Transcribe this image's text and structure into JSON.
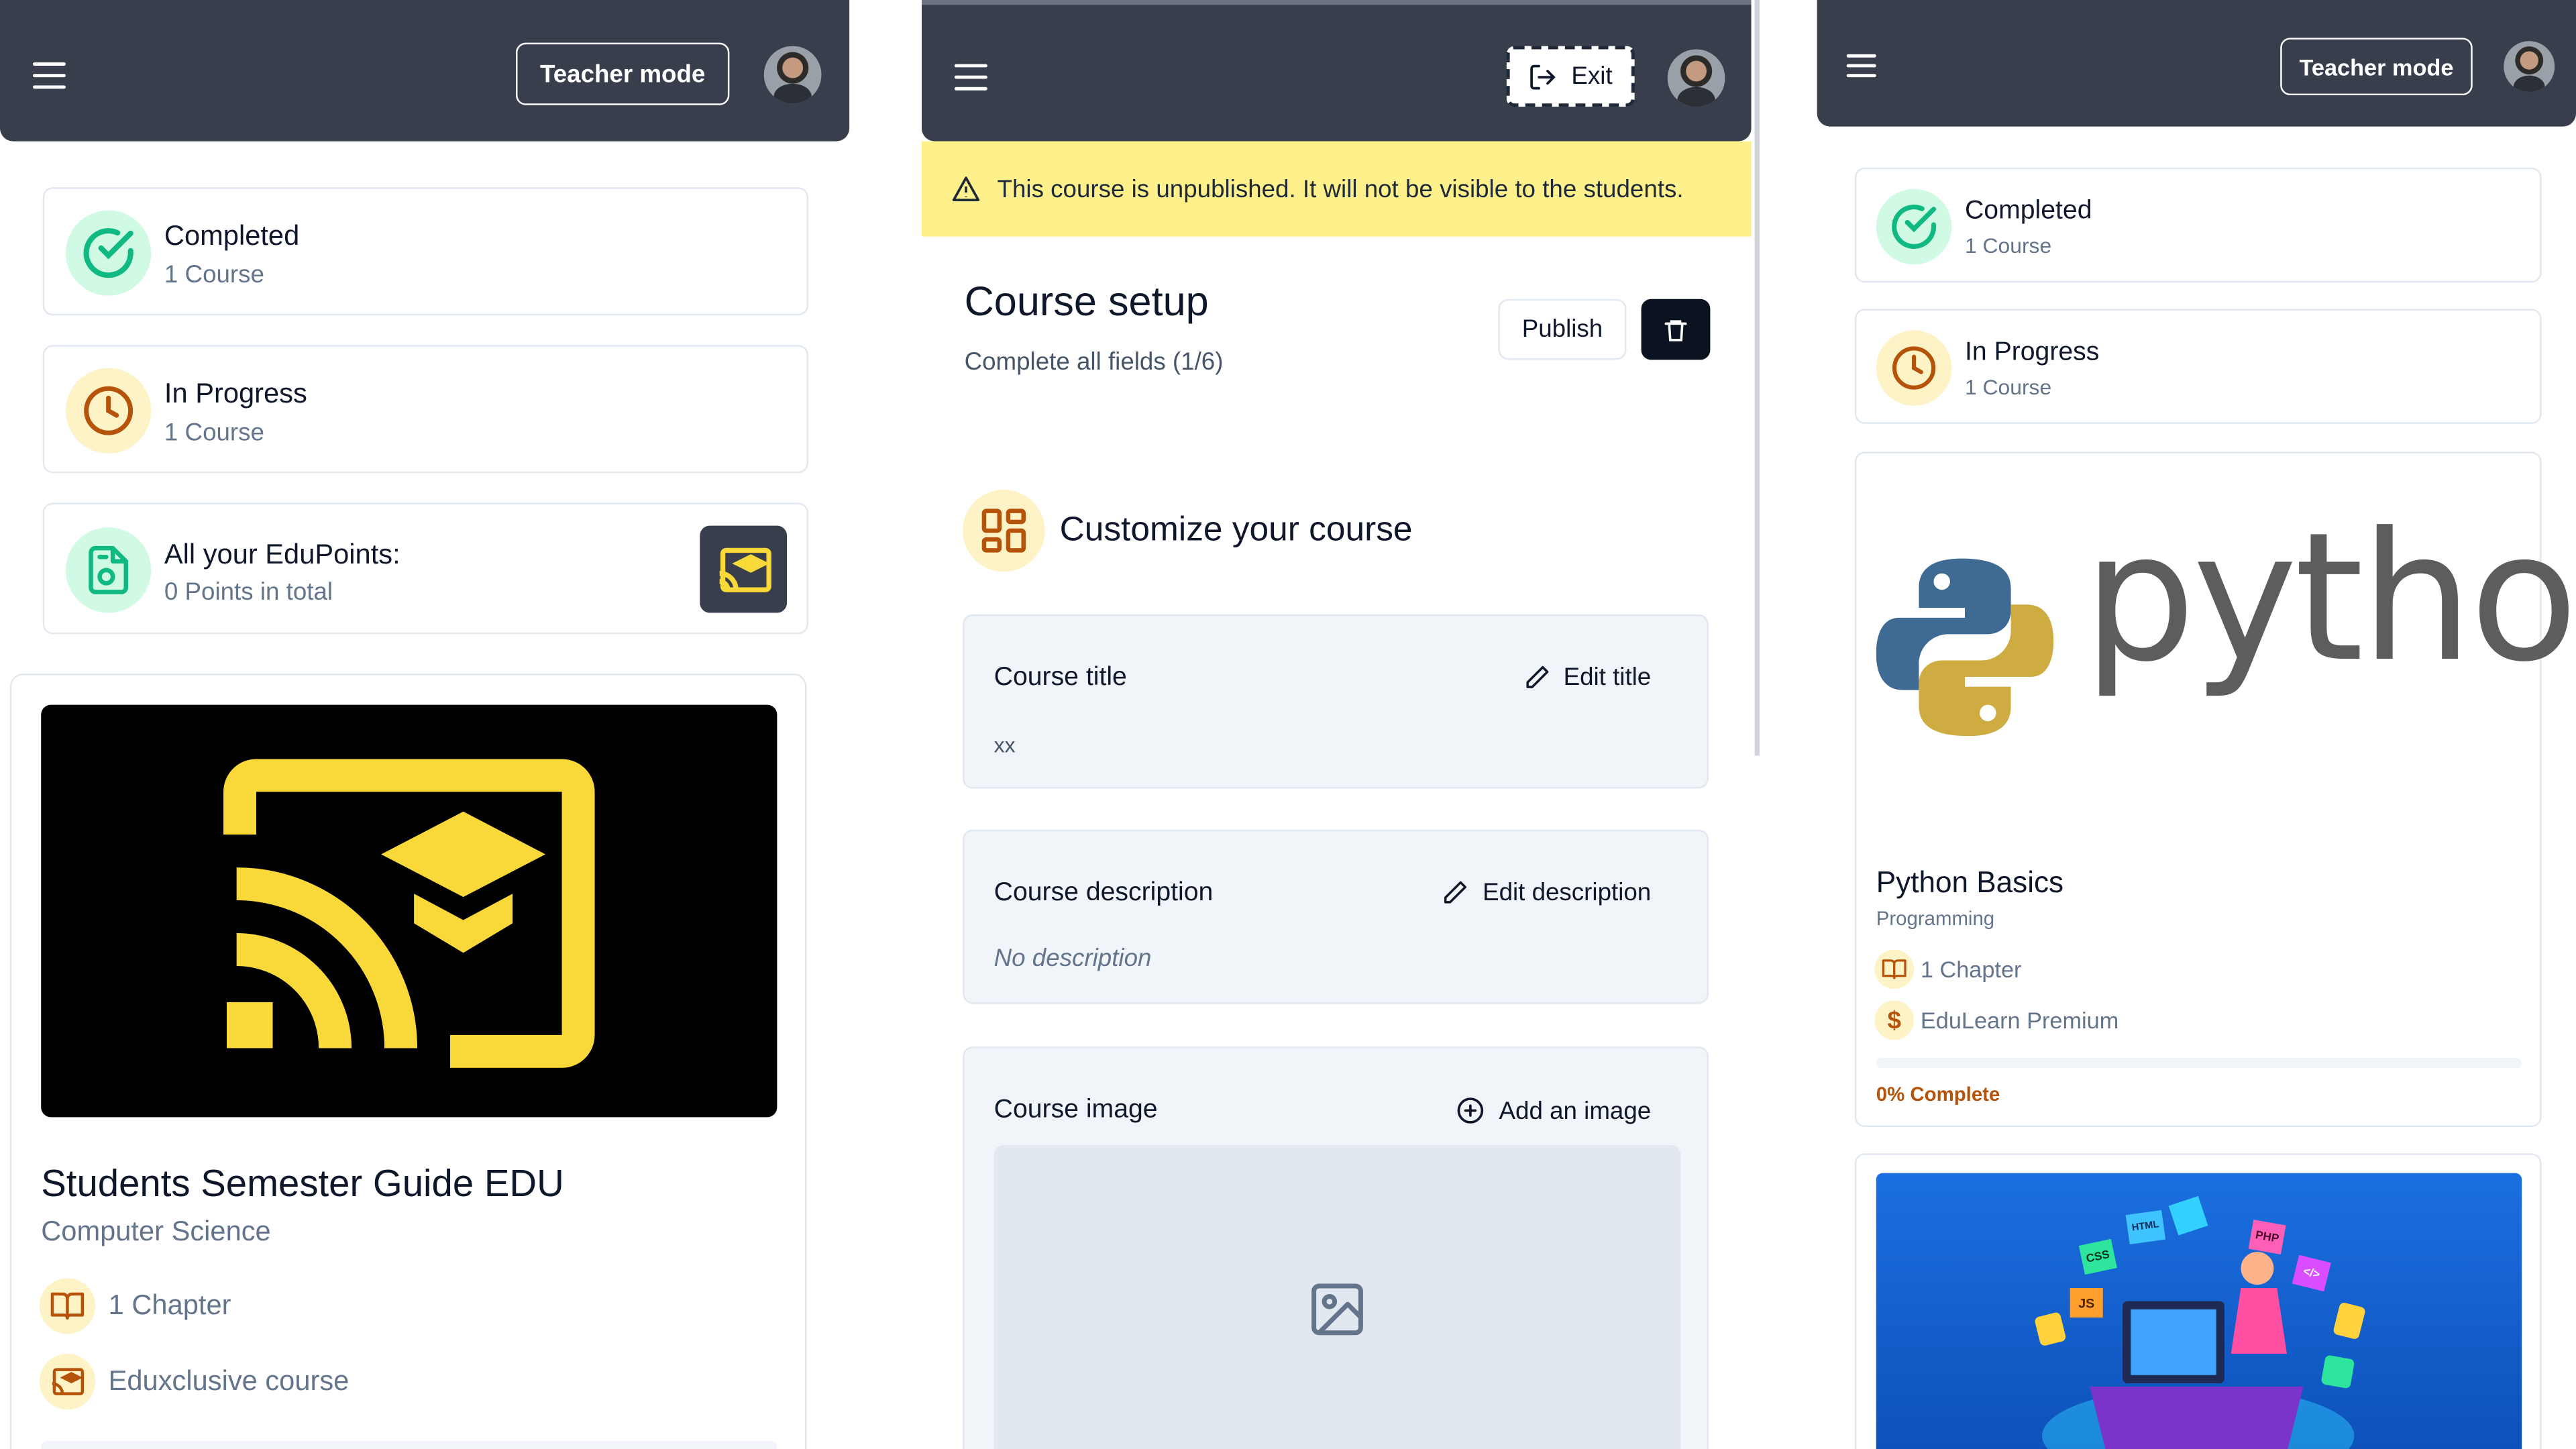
{
  "panel1": {
    "header": {
      "teacher_mode": "Teacher mode"
    },
    "stats": [
      {
        "title": "Completed",
        "sub": "1 Course"
      },
      {
        "title": "In Progress",
        "sub": "1 Course"
      },
      {
        "title": "All your EduPoints:",
        "sub": "0 Points in total"
      }
    ],
    "course": {
      "title": "Students Semester Guide EDU",
      "category": "Computer Science",
      "chapters": "1 Chapter",
      "badge": "Eduxclusive course"
    }
  },
  "panel2": {
    "header": {
      "exit": "Exit"
    },
    "banner": "This course is unpublished. It will not be visible to the students.",
    "setup_title": "Course setup",
    "setup_sub": "Complete all fields (1/6)",
    "publish": "Publish",
    "customize": "Customize your course",
    "fields": {
      "title_label": "Course title",
      "title_action": "Edit title",
      "title_value": "xx",
      "desc_label": "Course description",
      "desc_action": "Edit description",
      "desc_value": "No description",
      "image_label": "Course image",
      "image_action": "Add an image"
    }
  },
  "panel3": {
    "header": {
      "teacher_mode": "Teacher mode"
    },
    "stats": [
      {
        "title": "Completed",
        "sub": "1 Course"
      },
      {
        "title": "In Progress",
        "sub": "1 Course"
      }
    ],
    "course": {
      "logo_word": "python",
      "title": "Python Basics",
      "category": "Programming",
      "chapters": "1 Chapter",
      "price": "EduLearn Premium",
      "progress_pct": 0,
      "progress_label": "0% Complete"
    },
    "illustration_tags": [
      "CSS",
      "HTML",
      "JS",
      "PHP",
      "</>"
    ]
  },
  "colors": {
    "header": "#383e4c",
    "brand_yellow": "#f9d83a",
    "green": "#10b981",
    "amber": "#b45309"
  }
}
